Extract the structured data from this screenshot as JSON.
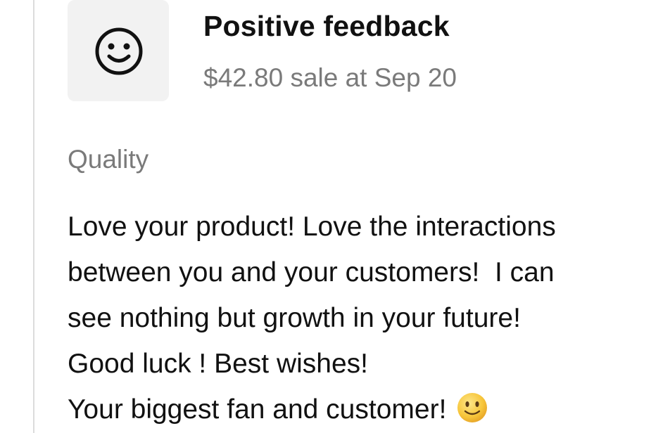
{
  "feedback": {
    "icon": "smiley-face-icon",
    "title": "Positive feedback",
    "subtitle": "$42.80 sale at Sep 20",
    "category": "Quality",
    "message_lines": [
      "Love your product! Love the interactions",
      "between you and your customers!  I can",
      "see nothing but growth in your future!",
      "Good luck ! Best wishes!",
      "Your biggest fan and customer!"
    ],
    "trailing_emoji": "slightly-smiling-face-emoji"
  },
  "colors": {
    "text_primary": "#111111",
    "text_secondary": "#7a7a7a",
    "icon_tile_bg": "#f2f2f2",
    "divider": "#dcdcdc",
    "emoji_yellow": "#f7c63b"
  }
}
